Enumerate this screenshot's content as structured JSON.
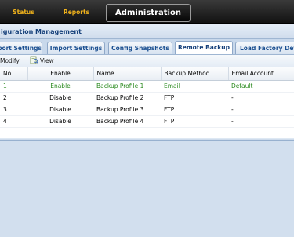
{
  "nav": {
    "tabs": [
      "Status",
      "Reports",
      "Administration"
    ],
    "active": "Administration"
  },
  "section_title": "iguration Management",
  "subtabs": [
    "port Settings",
    "Import Settings",
    "Config Snapshots",
    "Remote Backup",
    "Load Factory Defa"
  ],
  "active_subtab": "Remote Backup",
  "toolbar": {
    "modify_label": "Modify",
    "view_label": "View"
  },
  "table": {
    "columns": [
      "No",
      "Enable",
      "Name",
      "Backup Method",
      "Email Account"
    ],
    "rows": [
      [
        "1",
        "Enable",
        "Backup Profile 1",
        "Email",
        "Default"
      ],
      [
        "2",
        "Disable",
        "Backup Profile 2",
        "FTP",
        "-"
      ],
      [
        "3",
        "Disable",
        "Backup Profile 3",
        "FTP",
        "-"
      ],
      [
        "4",
        "Disable",
        "Backup Profile 4",
        "FTP",
        "-"
      ]
    ]
  },
  "colors": {
    "nav_accent": "#f0b21b",
    "active_row": "#2a8a1e",
    "title_blue": "#16407a"
  }
}
